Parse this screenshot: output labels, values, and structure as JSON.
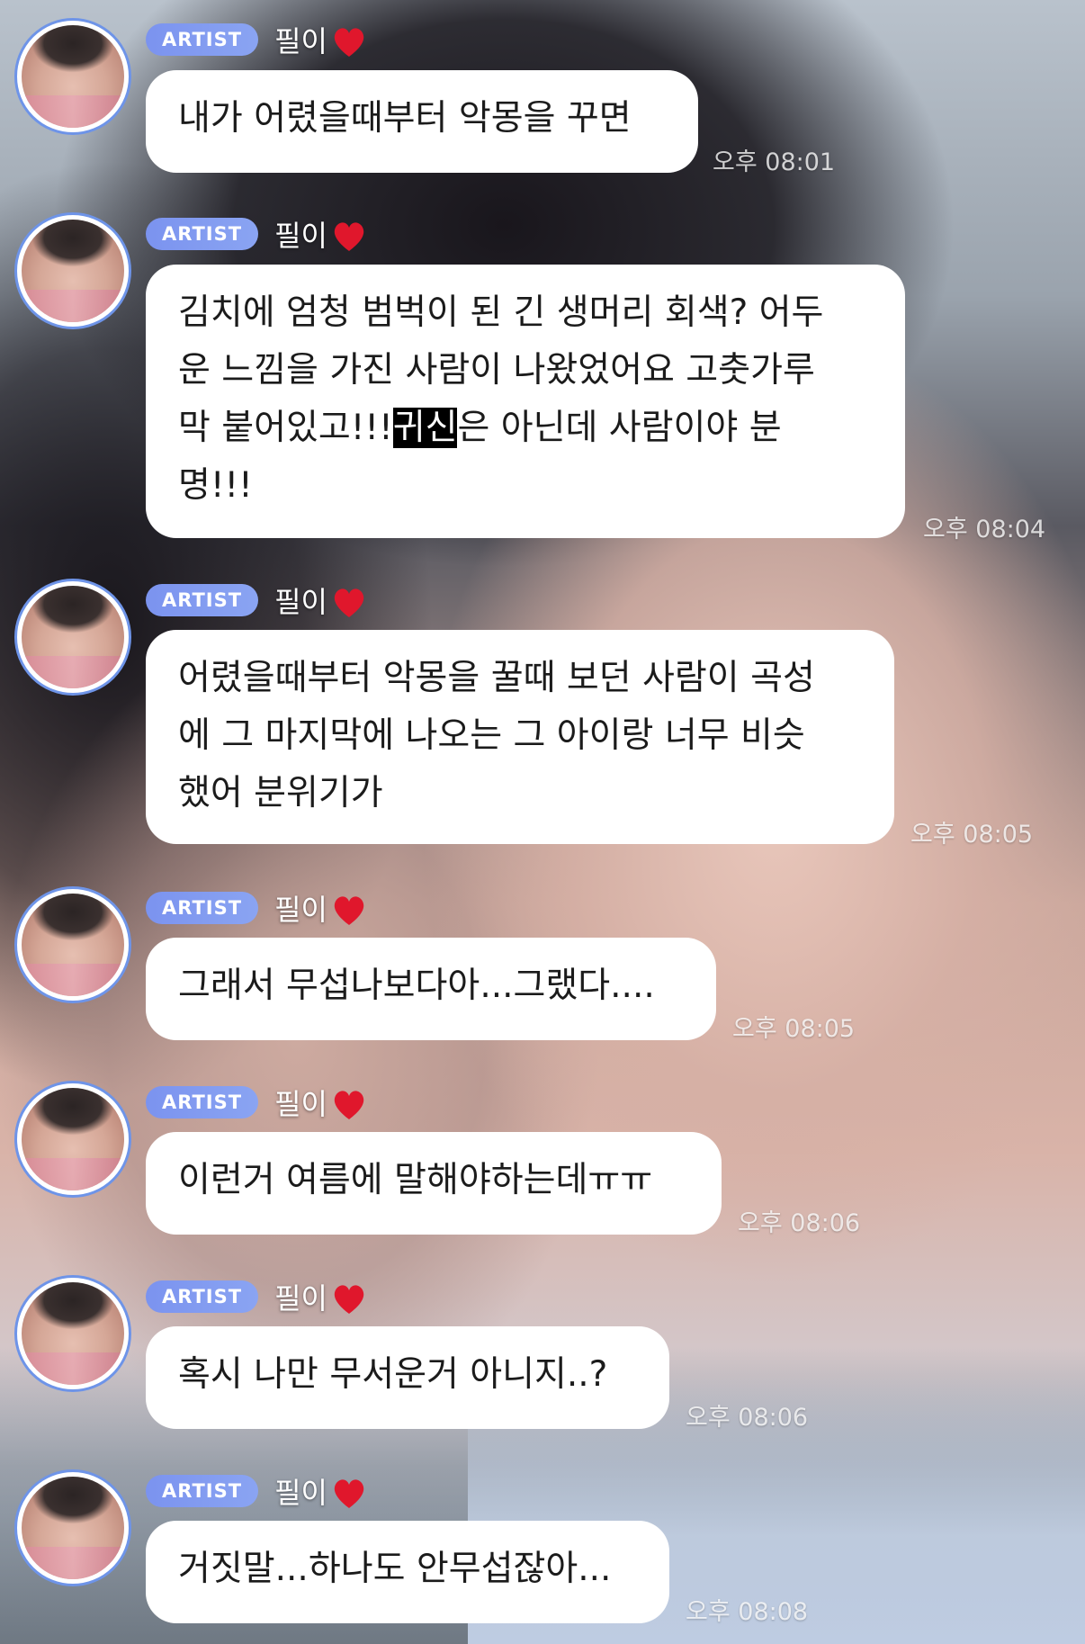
{
  "chat": {
    "badge": "ARTIST",
    "sender": "필이",
    "heart_icon": "red-heart-icon",
    "heart_color": "#e0172c",
    "badge_color": "#7b93ef",
    "avatar_ring_color": "#6e94e8",
    "messages": [
      {
        "text": "내가 어렸을때부터 악몽을 꾸면",
        "time": "오후 08:01"
      },
      {
        "text_before": "김치에 엄청 범벅이 된 긴 생머리 회색? 어두\n운 느낌을 가진 사람이 나왔었어요 고춧가루\n막 붙어있고!!!",
        "highlight": "귀신",
        "text_after": "은 아닌데 사람이야 분\n명!!!",
        "time": "오후 08:04"
      },
      {
        "text": "어렸을때부터 악몽을 꿀때 보던 사람이 곡성\n에 그 마지막에 나오는 그 아이랑 너무 비슷\n했어 분위기가",
        "time": "오후 08:05"
      },
      {
        "text": "그래서 무섭나보다아...그랬다....",
        "time": "오후 08:05"
      },
      {
        "text": "이런거 여름에 말해야하는데ㅠㅠ",
        "time": "오후 08:06"
      },
      {
        "text": "혹시 나만 무서운거 아니지..?",
        "time": "오후 08:06"
      },
      {
        "text": "거짓말...하나도 안무섭잖아...",
        "time": "오후 08:08"
      }
    ]
  }
}
